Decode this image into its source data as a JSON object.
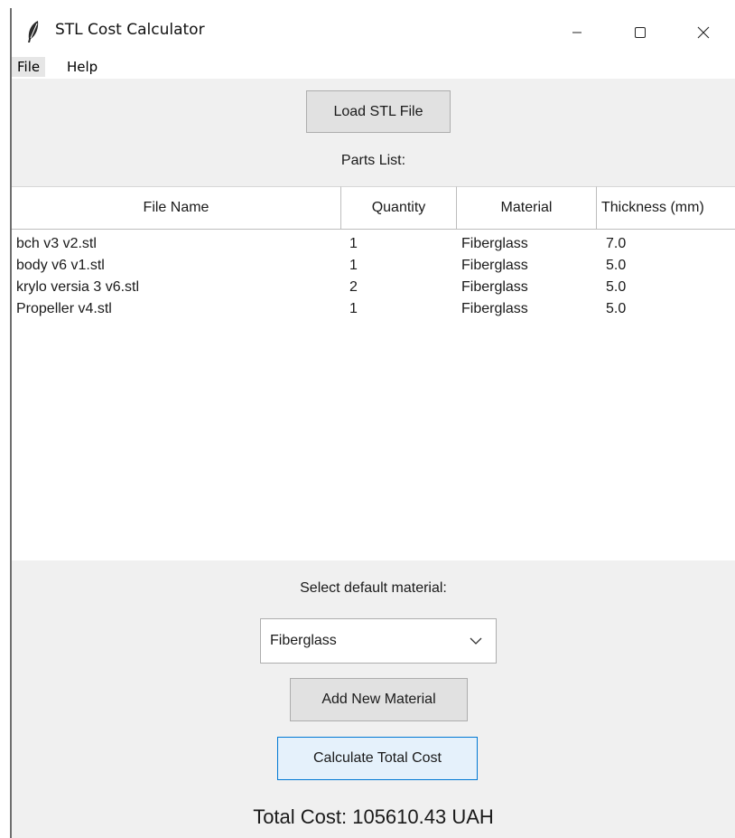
{
  "window": {
    "title": "STL Cost Calculator",
    "icon": "feather-icon",
    "controls": [
      "minimize-icon",
      "maximize-icon",
      "close-icon"
    ]
  },
  "menu": {
    "file": "File",
    "help": "Help"
  },
  "toolbar": {
    "load_label": "Load STL File"
  },
  "parts": {
    "label": "Parts List:",
    "columns": [
      "File Name",
      "Quantity",
      "Material",
      "Thickness (mm)"
    ],
    "rows": [
      [
        "bch v3 v2.stl",
        "1",
        "Fiberglass",
        "7.0"
      ],
      [
        "body v6 v1.stl",
        "1",
        "Fiberglass",
        "5.0"
      ],
      [
        "krylo versia 3 v6.stl",
        "2",
        "Fiberglass",
        "5.0"
      ],
      [
        "Propeller v4.stl",
        "1",
        "Fiberglass",
        "5.0"
      ]
    ]
  },
  "material": {
    "label": "Select default material:",
    "selected": "Fiberglass",
    "add_label": "Add New Material"
  },
  "cost": {
    "calc_label": "Calculate Total Cost",
    "total": "Total Cost: 105610.43 UAH"
  },
  "colors": {
    "accent": "#0078d4",
    "panel": "#f0f0f0",
    "button": "#e1e1e1"
  }
}
